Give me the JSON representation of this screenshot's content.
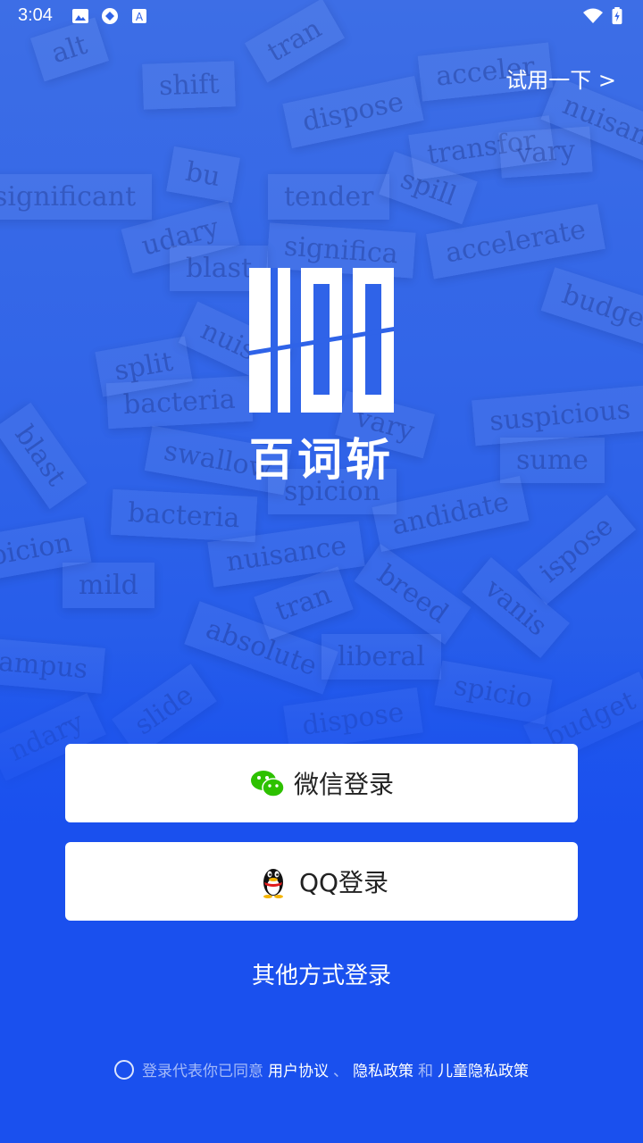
{
  "status_bar": {
    "time": "3:04"
  },
  "header": {
    "try_link": "试用一下 >"
  },
  "app": {
    "name": "百词斩"
  },
  "buttons": {
    "wechat_login": "微信登录",
    "qq_login": "QQ登录",
    "other_login": "其他方式登录"
  },
  "agreement": {
    "prefix": "登录代表你已同意",
    "user_agreement": "用户协议",
    "separator": "、",
    "privacy_policy": "隐私政策",
    "and": "和",
    "child_privacy_policy": "儿童隐私政策"
  },
  "background_words": [
    "alt",
    "shift",
    "tran",
    "dispose",
    "acceler",
    "nuisan",
    "significant",
    "tender",
    "transfor",
    "vary",
    "spill",
    "udary",
    "bu",
    "significa",
    "accelerate",
    "budget",
    "blast",
    "nuisa",
    "split",
    "bacteria",
    "suspicious",
    "sume",
    "blast",
    "swallow",
    "vary",
    "spicion",
    "bacteria",
    "andidate",
    "ispose",
    "picion",
    "nuisance",
    "mild",
    "tran",
    "breed",
    "vanis",
    "absolute",
    "liberal",
    "ampus",
    "slide",
    "dispose",
    "budget",
    "ndary",
    "spicio"
  ],
  "colors": {
    "background": "#2f63e8",
    "button_bg": "#ffffff",
    "wechat_green": "#2dc100",
    "text_white": "#ffffff"
  }
}
